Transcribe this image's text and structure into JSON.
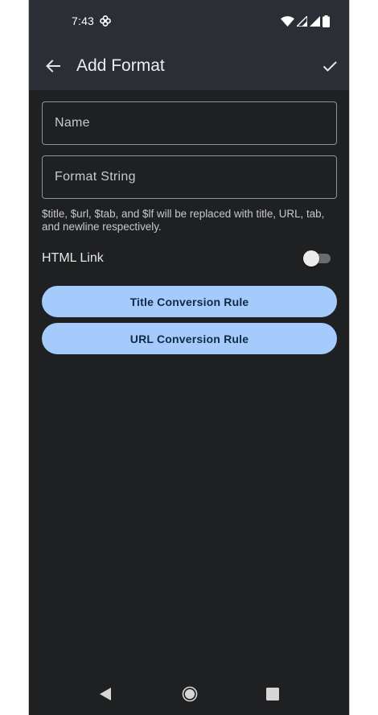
{
  "status_bar": {
    "time": "7:43",
    "icons": [
      "pinwheel-icon",
      "wifi-icon",
      "signal-icon",
      "signal-icon",
      "battery-icon"
    ]
  },
  "app_bar": {
    "title": "Add Format",
    "back_icon": "arrow-back-icon",
    "confirm_icon": "check-icon"
  },
  "form": {
    "name_field": {
      "placeholder": "Name",
      "value": ""
    },
    "format_field": {
      "placeholder": "Format String",
      "value": ""
    },
    "hint": "$title, $url, $tab, and $lf will be replaced with title, URL, tab, and newline respectively.",
    "html_link": {
      "label": "HTML Link",
      "enabled": false
    },
    "title_rule_button": "Title Conversion Rule",
    "url_rule_button": "URL Conversion Rule"
  },
  "nav_bar": {
    "icons": [
      "nav-back-icon",
      "nav-home-icon",
      "nav-recents-icon"
    ]
  },
  "colors": {
    "background": "#1f2022",
    "app_bar": "#2b2f35",
    "button": "#a4cbfb",
    "button_text": "#0f2a48"
  }
}
